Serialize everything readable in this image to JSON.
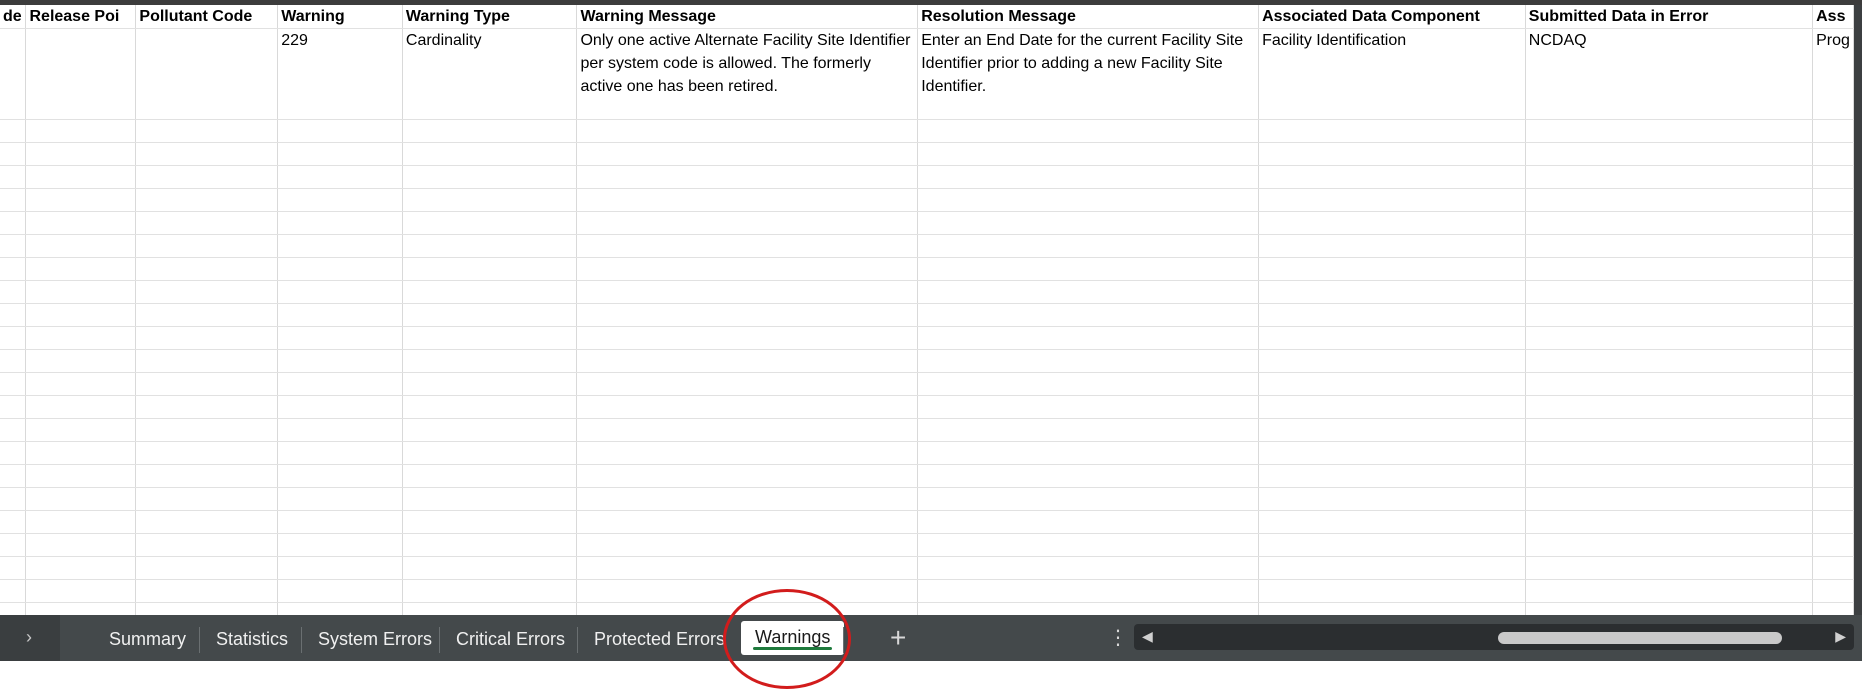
{
  "sheet": {
    "headers": [
      "de",
      "Release Poi",
      "Pollutant Code",
      "Warning",
      "Warning Type",
      "Warning Message",
      "Resolution Message",
      "Associated Data Component",
      "Submitted Data in Error",
      "Ass"
    ],
    "row1": [
      "",
      "",
      "",
      "229",
      "Cardinality",
      "Only one active Alternate Facility Site Identifier per system code is allowed. The formerly active one has been retired.",
      "Enter an End Date for the current Facility Site Identifier prior to adding a new Facility Site Identifier.",
      "Facility Identification",
      "NCDAQ",
      "Prog"
    ]
  },
  "tabs": {
    "nav_chevron": "›",
    "items": [
      "Summary",
      "Statistics",
      "System Errors",
      "Critical Errors",
      "Protected Errors",
      "Warnings"
    ],
    "active": "Warnings",
    "add_label": "+",
    "more_label": "⋮"
  },
  "scrollbar": {
    "left_arrow": "◀",
    "right_arrow": "▶"
  },
  "colors": {
    "annotation": "#d21c1c",
    "active_tab_underline": "#1e7a3c",
    "tab_bar": "#44494b"
  }
}
